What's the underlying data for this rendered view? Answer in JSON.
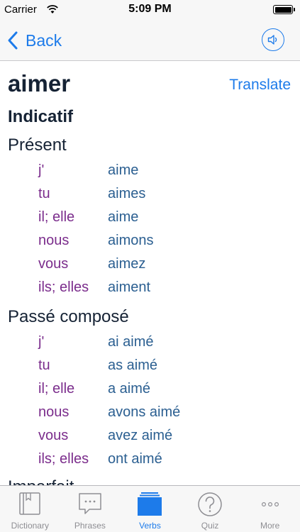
{
  "status_bar": {
    "carrier": "Carrier",
    "time": "5:09 PM",
    "battery_level": 1.0
  },
  "nav": {
    "back_label": "Back",
    "speaker_icon": "speaker-icon"
  },
  "verb": {
    "infinitive": "aimer",
    "translate_label": "Translate",
    "mood": "Indicatif",
    "tenses": [
      {
        "name": "Présent",
        "rows": [
          {
            "pronoun": "j'",
            "form": "aime"
          },
          {
            "pronoun": "tu",
            "form": "aimes"
          },
          {
            "pronoun": "il; elle",
            "form": "aime"
          },
          {
            "pronoun": "nous",
            "form": "aimons"
          },
          {
            "pronoun": "vous",
            "form": "aimez"
          },
          {
            "pronoun": "ils; elles",
            "form": "aiment"
          }
        ]
      },
      {
        "name": "Passé composé",
        "rows": [
          {
            "pronoun": "j'",
            "form": "ai aimé"
          },
          {
            "pronoun": "tu",
            "form": "as aimé"
          },
          {
            "pronoun": "il; elle",
            "form": "a aimé"
          },
          {
            "pronoun": "nous",
            "form": "avons aimé"
          },
          {
            "pronoun": "vous",
            "form": "avez aimé"
          },
          {
            "pronoun": "ils; elles",
            "form": "ont aimé"
          }
        ]
      },
      {
        "name": "Imparfait",
        "rows": []
      }
    ]
  },
  "tabs": [
    {
      "label": "Dictionary",
      "icon": "book-icon",
      "active": false
    },
    {
      "label": "Phrases",
      "icon": "speech-bubble-icon",
      "active": false
    },
    {
      "label": "Verbs",
      "icon": "cards-icon",
      "active": true
    },
    {
      "label": "Quiz",
      "icon": "question-icon",
      "active": false
    },
    {
      "label": "More",
      "icon": "more-icon",
      "active": false
    }
  ],
  "colors": {
    "accent": "#1d7bea",
    "pronoun": "#7b2d8c",
    "form": "#2b5f91",
    "title": "#152234",
    "inactive_tab": "#8e8e93"
  }
}
